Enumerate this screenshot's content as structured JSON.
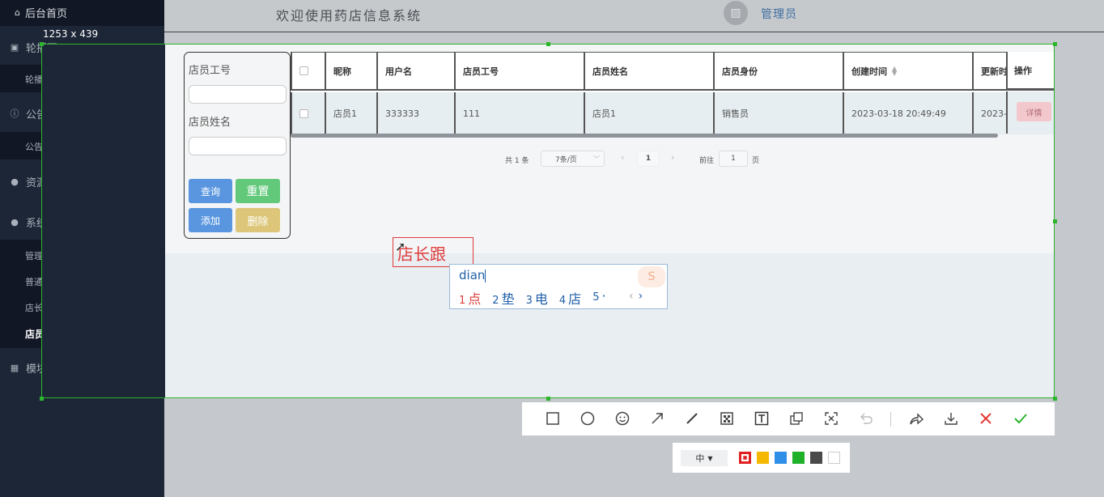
{
  "sidebar": {
    "home": "后台首页",
    "menus": [
      {
        "label": "轮播图",
        "icon": "image-icon"
      },
      {
        "label": "公告管理",
        "icon": "info-icon"
      },
      {
        "label": "资源管理",
        "icon": "location-icon"
      },
      {
        "label": "系统用户",
        "icon": "user-icon"
      },
      {
        "label": "模块管理",
        "icon": "grid-icon"
      }
    ],
    "sub": {
      "carousel": "轮播图管理",
      "notice": "公告",
      "admin": "管理员",
      "normal_user": "普通用户",
      "manager_user": "店长用户",
      "staff_user": "店员用户"
    }
  },
  "header": {
    "title": "欢迎使用药店信息系统",
    "user": "管理员"
  },
  "screenshot": {
    "dimensions": "1253 x 439"
  },
  "search": {
    "staff_no_label": "店员工号",
    "staff_name_label": "店员姓名",
    "query": "查询",
    "reset": "重置",
    "add": "添加",
    "delete": "删除"
  },
  "table": {
    "headers": [
      "昵称",
      "用户名",
      "店员工号",
      "店员姓名",
      "店员身份",
      "创建时间",
      "更新时",
      "操作"
    ],
    "rows": [
      [
        "店员1",
        "333333",
        "111",
        "店员1",
        "销售员",
        "2023-03-18 20:49:49",
        "2023-"
      ]
    ],
    "detail_button": "详情"
  },
  "pagination": {
    "total": "共 1 条",
    "page_size": "7条/页",
    "current_page": "1",
    "goto_label": "前往",
    "goto_value": "1",
    "page_unit": "页"
  },
  "annotation": {
    "text": "店长跟"
  },
  "ime": {
    "input": "dian",
    "candidates": [
      {
        "num": "1",
        "char": "点"
      },
      {
        "num": "2",
        "char": "垫"
      },
      {
        "num": "3",
        "char": "电"
      },
      {
        "num": "4",
        "char": "店"
      },
      {
        "num": "5",
        "char": "·"
      }
    ]
  },
  "toolbar": {
    "tools": [
      "rectangle-icon",
      "ellipse-icon",
      "emoji-icon",
      "arrow-icon",
      "pen-icon",
      "mosaic-icon",
      "text-icon",
      "pin-icon",
      "ocr-icon",
      "undo-icon",
      "share-icon",
      "download-icon",
      "close-icon",
      "confirm-icon"
    ],
    "size": "中",
    "colors": [
      "#e02020",
      "#f5b800",
      "#2f8fe8",
      "#1fb12a",
      "#4a4a4a",
      "#ffffff"
    ]
  }
}
